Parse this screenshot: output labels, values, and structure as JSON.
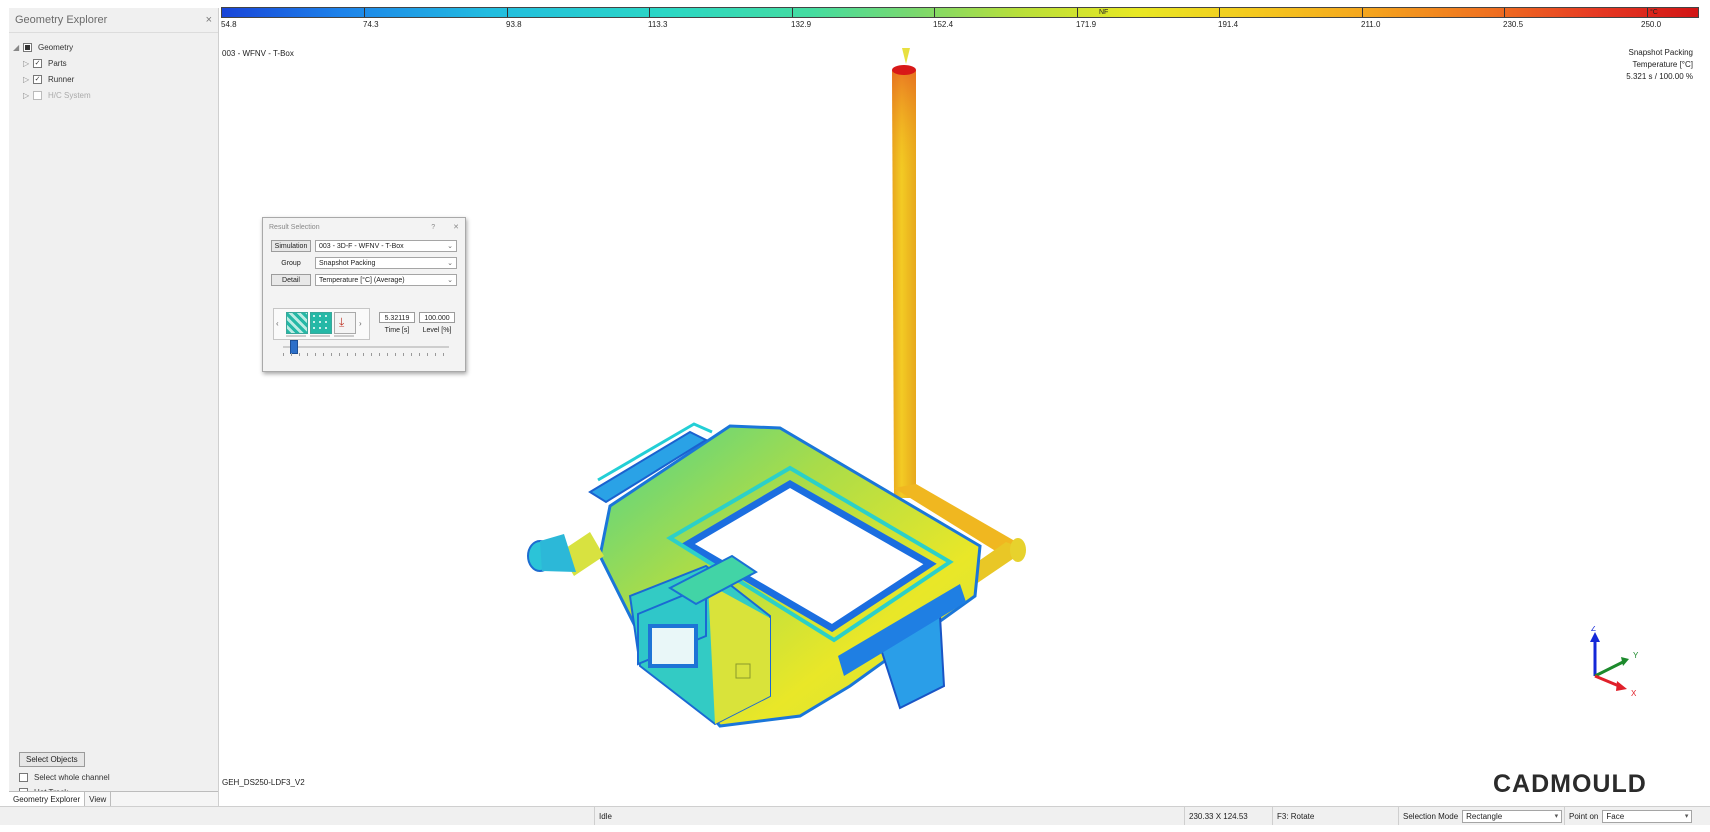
{
  "left_panel": {
    "title": "Geometry Explorer",
    "close": "×",
    "tree": [
      {
        "label": "Geometry",
        "expander": "◢",
        "check": "filled"
      },
      {
        "label": "Parts",
        "expander": "▷",
        "check": "✓"
      },
      {
        "label": "Runner",
        "expander": "▷",
        "check": "✓"
      },
      {
        "label": "H/C System",
        "expander": "▷",
        "check": ""
      }
    ],
    "select_objects": "Select Objects",
    "select_whole_channel": "Select whole channel",
    "hot_track": "Hot Track",
    "tabs": [
      "Geometry Explorer",
      "View"
    ]
  },
  "colorbar": {
    "labels": [
      "54.8",
      "74.3",
      "93.8",
      "113.3",
      "132.9",
      "152.4",
      "171.9",
      "191.4",
      "211.0",
      "230.5",
      "250.0"
    ],
    "marker_nf": "NF",
    "marker_unit": "°C"
  },
  "viewport": {
    "simulation_label": "003 - WFNV - T-Box",
    "info_line1": "Snapshot Packing",
    "info_line2": "Temperature [°C]",
    "info_line3": "5.321 s  /  100.00 %",
    "part_name": "GEH_DS250-LDF3_V2",
    "logo": "CADMOULD",
    "axis_x": "X",
    "axis_y": "Y",
    "axis_z": "Z"
  },
  "dialog": {
    "title": "Result Selection",
    "help": "?",
    "close": "✕",
    "simulation_btn": "Simulation",
    "simulation_value": "003  -  3D-F  -  WFNV - T-Box",
    "group_label": "Group",
    "group_value": "Snapshot Packing",
    "detail_btn": "Detail",
    "detail_value": "Temperature [°C] (Average)",
    "time_value": "5.32119",
    "level_value": "100.000",
    "time_label": "Time [s]",
    "level_label": "Level [%]",
    "prev": "‹",
    "next": "›",
    "chevron": "⌄",
    "slider_level": 0.04
  },
  "statusbar": {
    "state": "Idle",
    "dimensions": "230.33 X 124.53",
    "hint": "F3: Rotate",
    "selection_mode_label": "Selection Mode",
    "selection_mode_value": "Rectangle",
    "point_on_label": "Point on",
    "point_on_value": "Face",
    "chevron": "▾"
  }
}
